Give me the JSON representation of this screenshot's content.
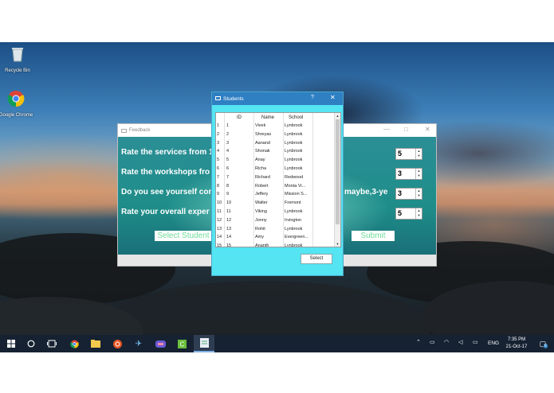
{
  "desktop": {
    "icons": [
      {
        "label": "Recycle Bin",
        "icon": "recycle-bin-icon"
      },
      {
        "label": "Google Chrome",
        "icon": "chrome-icon"
      }
    ]
  },
  "feedback": {
    "title": "Feedback",
    "questions": [
      "Rate the services from 1-",
      "Rate the workshops fro",
      "Do you see yourself com",
      "Rate your overall exper"
    ],
    "clipped_right_text": "maybe,3-ye",
    "ratings": [
      "5",
      "3",
      "3",
      "5"
    ],
    "select_students_label": "Select Student",
    "submit_label": "Submit",
    "accent_text_color": "#6fdc9a"
  },
  "students": {
    "title": "Students",
    "help_label": "?",
    "close_label": "✕",
    "columns": [
      "ID",
      "Name",
      "School"
    ],
    "rows": [
      {
        "n": "1",
        "id": "1",
        "name": "Vivek",
        "school": "Lynbrook"
      },
      {
        "n": "2",
        "id": "2",
        "name": "Shreyas",
        "school": "Lynbrook"
      },
      {
        "n": "3",
        "id": "3",
        "name": "Aanand",
        "school": "Lynbrook"
      },
      {
        "n": "4",
        "id": "4",
        "name": "Shonak",
        "school": "Lynbrook"
      },
      {
        "n": "5",
        "id": "5",
        "name": "Anay",
        "school": "Lynbrook"
      },
      {
        "n": "6",
        "id": "6",
        "name": "Richa",
        "school": "Lynbrook"
      },
      {
        "n": "7",
        "id": "7",
        "name": "Richard",
        "school": "Redwood"
      },
      {
        "n": "8",
        "id": "8",
        "name": "Robert",
        "school": "Monta Vi..."
      },
      {
        "n": "9",
        "id": "9",
        "name": "Jeffery",
        "school": "Mission S..."
      },
      {
        "n": "10",
        "id": "10",
        "name": "Walter",
        "school": "Fremont"
      },
      {
        "n": "11",
        "id": "11",
        "name": "Viking",
        "school": "Lynbrook"
      },
      {
        "n": "12",
        "id": "12",
        "name": "Jonny",
        "school": "Irvington"
      },
      {
        "n": "13",
        "id": "13",
        "name": "Rohit",
        "school": "Lynbrook"
      },
      {
        "n": "14",
        "id": "14",
        "name": "Amy",
        "school": "Evergreen..."
      },
      {
        "n": "15",
        "id": "15",
        "name": "Ananth",
        "school": "Lynbrook"
      }
    ],
    "select_label": "Select",
    "dialog_color": "#54e4f2",
    "titlebar_color": "#2f7fc3"
  },
  "taskbar": {
    "apps": [
      "start-icon",
      "search-icon",
      "task-view-icon",
      "chrome-icon",
      "file-explorer-icon",
      "ubuntu-icon",
      "airplane-app-icon",
      "media-app-icon",
      "code-app-icon",
      "notepad-app-icon"
    ],
    "language": "ENG",
    "time": "7:35 PM",
    "date": "21-Oct-17",
    "notification_count": "6"
  }
}
